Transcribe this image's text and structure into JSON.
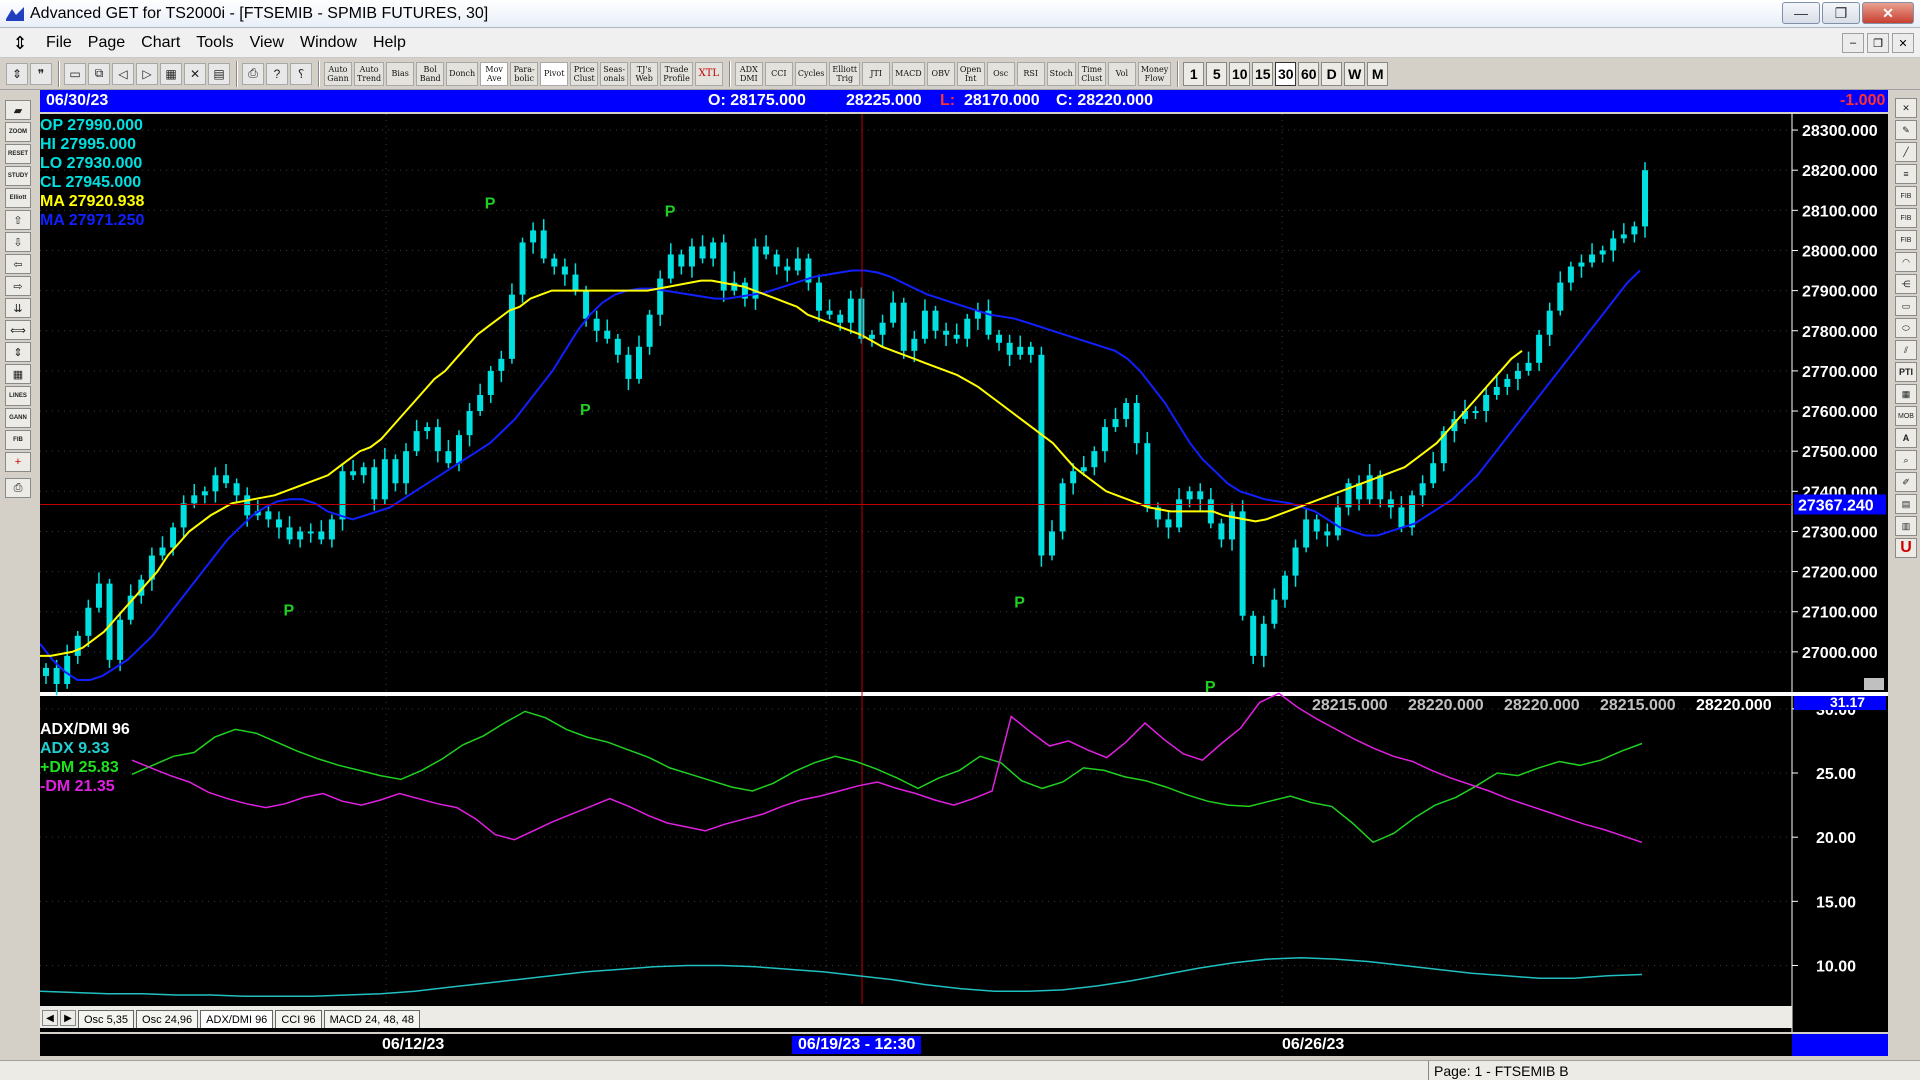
{
  "window": {
    "title": "Advanced GET for TS2000i - [FTSEMIB - SPMIB FUTURES, 30]",
    "buttons": {
      "minimize": "—",
      "maximize": "❐",
      "close": "✕"
    }
  },
  "menu": {
    "items": [
      "File",
      "Page",
      "Chart",
      "Tools",
      "View",
      "Window",
      "Help"
    ],
    "mdi_buttons": [
      "–",
      "❐",
      "✕"
    ]
  },
  "toolbar": {
    "study_buttons": [
      "Auto\nGann",
      "Auto\nTrend",
      "Bias",
      "Bol\nBand",
      "Donch",
      "Mov\nAve",
      "Para-\nbolic",
      "Pivot",
      "Price\nClust",
      "Seas-\nonals",
      "TJ's\nWeb",
      "Trade\nProfile",
      "XTL"
    ],
    "indicator_buttons": [
      "ADX\nDMI",
      "CCI",
      "Cycles",
      "Elliott\nTrig",
      "JTI",
      "MACD",
      "OBV",
      "Open\nInt",
      "Osc",
      "RSI",
      "Stoch",
      "Time\nClust",
      "Vol",
      "Money\nFlow"
    ],
    "intervals": [
      "1",
      "5",
      "10",
      "15",
      "30",
      "60",
      "D",
      "W",
      "M"
    ],
    "active_interval": "30"
  },
  "header": {
    "date": "06/30/23",
    "open": "O: 28175.000",
    "high": "28225.000",
    "low_label": "L:",
    "low": "28170.000",
    "close": "C: 28220.000",
    "change": "-1.000"
  },
  "readouts": {
    "op": "OP  27990.000",
    "hi": "HI   27995.000",
    "lo": "LO  27930.000",
    "cl": "CL  27945.000",
    "ma_yellow": "MA  27920.938",
    "ma_blue": "MA  27971.250"
  },
  "adx_readouts": {
    "title": "ADX/DMI 96",
    "adx": "ADX 9.33",
    "pdm": "+DM 25.83",
    "mdm": "-DM  21.35"
  },
  "price_bottom_values": [
    "28215.000",
    "28220.000",
    "28220.000",
    "28215.000",
    "28220.000"
  ],
  "tabs": [
    "Osc 5,35",
    "Osc 24,96",
    "ADX/DMI 96",
    "CCI 96",
    "MACD 24, 48, 48"
  ],
  "active_tab": "ADX/DMI 96",
  "time_axis": {
    "labels": [
      "06/12/23",
      "06/19/23 - 12:30",
      "06/26/23"
    ]
  },
  "status": "Page: 1 - FTSEMIB B",
  "colors": {
    "candle": "#00e0e0",
    "ma_fast": "#ffff00",
    "ma_slow": "#1020ff",
    "pdm": "#20d020",
    "mdm": "#e020e0",
    "adx": "#20c0c0",
    "header": "#0000ff",
    "pivot": "#20d020",
    "crosshair": "#c00000"
  },
  "chart_data": [
    {
      "type": "candlestick",
      "title": "FTSEMIB - SPMIB FUTURES, 30",
      "y_range": [
        26900,
        28340
      ],
      "y_ticks": [
        "28300.000",
        "28200.000",
        "28100.000",
        "28000.000",
        "27900.000",
        "27800.000",
        "27700.000",
        "27600.000",
        "27500.000",
        "27400.000",
        "27300.000",
        "27200.000",
        "27100.000",
        "27000.000"
      ],
      "crosshair_price": "27367.240",
      "pivots": [
        {
          "label": "P",
          "bar": 23,
          "price": 27150,
          "position": "below"
        },
        {
          "label": "P",
          "bar": 42,
          "price": 28080,
          "position": "above"
        },
        {
          "label": "P",
          "bar": 51,
          "price": 27650,
          "position": "below"
        },
        {
          "label": "P",
          "bar": 59,
          "price": 28060,
          "position": "above"
        },
        {
          "label": "P",
          "bar": 92,
          "price": 27170,
          "position": "below"
        },
        {
          "label": "P",
          "bar": 110,
          "price": 26960,
          "position": "below"
        }
      ],
      "series": [
        {
          "name": "MA",
          "values_ref": "ma_fast"
        },
        {
          "name": "MA",
          "values_ref": "ma_slow"
        }
      ],
      "close": [
        26960,
        26920,
        26990,
        27040,
        27110,
        27170,
        26980,
        27080,
        27140,
        27180,
        27240,
        27260,
        27310,
        27370,
        27390,
        27400,
        27440,
        27420,
        27390,
        27340,
        27350,
        27330,
        27310,
        27280,
        27300,
        27300,
        27280,
        27330,
        27450,
        27440,
        27460,
        27380,
        27480,
        27420,
        27500,
        27550,
        27560,
        27500,
        27470,
        27540,
        27600,
        27640,
        27700,
        27730,
        27890,
        28020,
        28050,
        27980,
        27960,
        27940,
        27900,
        27830,
        27800,
        27780,
        27740,
        27680,
        27760,
        27840,
        27930,
        27990,
        27960,
        28010,
        27980,
        28020,
        27900,
        27920,
        27880,
        28010,
        27990,
        27960,
        27950,
        27980,
        27920,
        27850,
        27840,
        27820,
        27880,
        27780,
        27790,
        27820,
        27870,
        27750,
        27780,
        27850,
        27800,
        27790,
        27780,
        27830,
        27850,
        27790,
        27770,
        27740,
        27760,
        27740,
        27240,
        27300,
        27420,
        27450,
        27460,
        27500,
        27560,
        27580,
        27620,
        27520,
        27360,
        27330,
        27310,
        27380,
        27400,
        27380,
        27320,
        27280,
        27350,
        27090,
        26990,
        27070,
        27130,
        27190,
        27260,
        27330,
        27300,
        27290,
        27360,
        27420,
        27380,
        27440,
        27380,
        27360,
        27310,
        27390,
        27420,
        27470,
        27550,
        27580,
        27600,
        27600,
        27640,
        27660,
        27680,
        27700,
        27720,
        27790,
        27850,
        27920,
        27960,
        27970,
        27990,
        28000,
        28030,
        28040,
        28060,
        28200
      ],
      "ma_fast": [
        26990,
        26990,
        26995,
        27000,
        27010,
        27030,
        27050,
        27080,
        27110,
        27140,
        27170,
        27200,
        27240,
        27270,
        27300,
        27320,
        27340,
        27355,
        27370,
        27375,
        27380,
        27385,
        27390,
        27400,
        27410,
        27420,
        27430,
        27440,
        27460,
        27480,
        27500,
        27510,
        27530,
        27560,
        27590,
        27620,
        27650,
        27680,
        27700,
        27730,
        27760,
        27790,
        27810,
        27830,
        27850,
        27860,
        27880,
        27890,
        27900,
        27900,
        27900,
        27900,
        27900,
        27900,
        27900,
        27900,
        27900,
        27900,
        27905,
        27910,
        27915,
        27920,
        27925,
        27925,
        27920,
        27915,
        27910,
        27900,
        27890,
        27880,
        27870,
        27860,
        27840,
        27830,
        27820,
        27810,
        27800,
        27790,
        27775,
        27760,
        27750,
        27740,
        27730,
        27720,
        27710,
        27700,
        27690,
        27675,
        27660,
        27640,
        27620,
        27600,
        27580,
        27560,
        27540,
        27520,
        27490,
        27460,
        27440,
        27420,
        27400,
        27390,
        27380,
        27370,
        27360,
        27355,
        27350,
        27350,
        27350,
        27350,
        27350,
        27340,
        27335,
        27330,
        27325,
        27330,
        27340,
        27350,
        27360,
        27370,
        27380,
        27390,
        27400,
        27410,
        27420,
        27430,
        27440,
        27450,
        27460,
        27480,
        27500,
        27520,
        27550,
        27580,
        27610,
        27640,
        27670,
        27700,
        27730,
        27750
      ],
      "ma_slow": [
        27020,
        26980,
        26950,
        26930,
        26930,
        26940,
        26960,
        26980,
        27010,
        27040,
        27080,
        27120,
        27160,
        27200,
        27240,
        27280,
        27310,
        27340,
        27360,
        27375,
        27380,
        27380,
        27370,
        27350,
        27340,
        27330,
        27340,
        27350,
        27360,
        27380,
        27400,
        27420,
        27440,
        27460,
        27480,
        27500,
        27520,
        27550,
        27580,
        27620,
        27660,
        27700,
        27750,
        27800,
        27840,
        27870,
        27890,
        27900,
        27905,
        27905,
        27900,
        27895,
        27890,
        27885,
        27880,
        27880,
        27885,
        27890,
        27895,
        27905,
        27915,
        27925,
        27935,
        27940,
        27945,
        27950,
        27950,
        27945,
        27935,
        27920,
        27905,
        27890,
        27880,
        27870,
        27860,
        27850,
        27840,
        27835,
        27830,
        27820,
        27810,
        27800,
        27790,
        27780,
        27770,
        27760,
        27750,
        27730,
        27700,
        27660,
        27620,
        27570,
        27520,
        27480,
        27450,
        27420,
        27400,
        27390,
        27380,
        27375,
        27370,
        27360,
        27350,
        27330,
        27310,
        27300,
        27290,
        27290,
        27300,
        27310,
        27320,
        27340,
        27360,
        27380,
        27410,
        27440,
        27480,
        27520,
        27560,
        27600,
        27640,
        27680,
        27720,
        27760,
        27800,
        27840,
        27880,
        27920,
        27950
      ]
    },
    {
      "type": "line",
      "title": "ADX/DMI 96",
      "y_range": [
        7,
        31
      ],
      "y_ticks": [
        "30.00",
        "25.00",
        "20.00",
        "15.00",
        "10.00"
      ],
      "top_value": "31.17",
      "series": [
        {
          "name": "+DM",
          "values": [
            24.9,
            25.6,
            26.3,
            26.6,
            27.8,
            28.4,
            28.1,
            27.4,
            26.7,
            26.1,
            25.6,
            25.2,
            24.8,
            24.5,
            25.2,
            26.1,
            27.2,
            27.9,
            28.9,
            29.8,
            29.3,
            28.4,
            27.8,
            27.4,
            26.8,
            26.2,
            25.4,
            24.9,
            24.4,
            23.9,
            23.6,
            24.2,
            25.1,
            25.8,
            26.3,
            25.9,
            25.3,
            24.6,
            23.8,
            24.6,
            25.2,
            26.3,
            25.8,
            24.4,
            23.8,
            24.3,
            25.4,
            25.2,
            24.7,
            24.4,
            23.9,
            23.3,
            22.8,
            22.5,
            22.4,
            22.8,
            23.2,
            22.7,
            22.4,
            21.1,
            19.6,
            20.3,
            21.5,
            22.5,
            23.1,
            24.0,
            25.0,
            24.8,
            25.4,
            25.9,
            25.6,
            26.0,
            26.7,
            27.3
          ]
        },
        {
          "name": "-DM",
          "values": [
            26.0,
            25.4,
            24.8,
            24.3,
            23.5,
            23.0,
            22.6,
            22.3,
            22.6,
            23.1,
            23.4,
            22.8,
            22.5,
            22.9,
            23.4,
            23.0,
            22.6,
            22.3,
            21.4,
            20.2,
            19.8,
            20.5,
            21.2,
            21.8,
            22.4,
            23.0,
            22.4,
            21.7,
            21.1,
            20.8,
            20.5,
            21.0,
            21.4,
            21.8,
            22.4,
            22.9,
            23.2,
            23.6,
            24.0,
            24.3,
            23.8,
            23.4,
            22.9,
            22.5,
            23.0,
            23.6,
            29.4,
            28.2,
            27.1,
            27.5,
            26.8,
            26.2,
            27.4,
            28.9,
            27.6,
            26.5,
            26.0,
            27.3,
            28.5,
            30.5,
            31.2,
            30.1,
            29.2,
            28.4,
            27.6,
            26.9,
            26.3,
            25.9,
            25.2,
            24.6,
            24.1,
            23.6,
            23.0,
            22.5,
            22.0,
            21.5,
            21.0,
            20.6,
            20.1,
            19.6
          ]
        },
        {
          "name": "ADX",
          "values": [
            8.0,
            7.9,
            7.8,
            7.8,
            7.7,
            7.7,
            7.6,
            7.6,
            7.6,
            7.7,
            7.8,
            8.0,
            8.3,
            8.6,
            8.9,
            9.2,
            9.5,
            9.7,
            9.9,
            10.0,
            10.0,
            9.9,
            9.7,
            9.5,
            9.2,
            8.9,
            8.5,
            8.2,
            8.0,
            8.0,
            8.1,
            8.4,
            8.8,
            9.3,
            9.8,
            10.2,
            10.5,
            10.6,
            10.5,
            10.3,
            10.0,
            9.7,
            9.4,
            9.2,
            9.0,
            9.0,
            9.2,
            9.3
          ]
        }
      ]
    }
  ]
}
